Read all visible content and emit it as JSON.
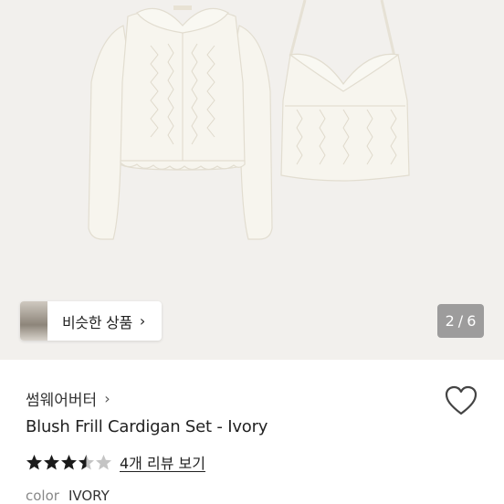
{
  "hero": {
    "similar_products_label": "비슷한 상품",
    "similar_chevron": "›",
    "page_current": "2",
    "page_separator": "/",
    "page_total": "6"
  },
  "shop": {
    "name": "썸웨어버터",
    "chevron": "›"
  },
  "product": {
    "title": "Blush Frill Cardigan Set - Ivory",
    "rating": 3.5,
    "rating_max": 5,
    "review_link": "4개 리뷰 보기",
    "color_label": "color",
    "color_value": "IVORY"
  },
  "colors": {
    "star_filled": "#1a1a1a",
    "star_empty": "#c4c4c4",
    "hero_bg": "#f2f0ed"
  }
}
